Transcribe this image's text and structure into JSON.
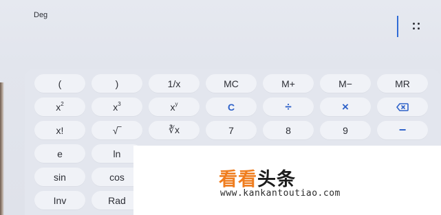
{
  "display": {
    "mode": "Deg"
  },
  "icons": {
    "menu": "grid-dots-icon",
    "backspace": "backspace-icon"
  },
  "colors": {
    "accent": "#2f62c9",
    "background": "#e3e6ee",
    "key": "#f0f2f7",
    "watermark_orange": "#ef7d1f"
  },
  "keys": {
    "row1": [
      "(",
      ")",
      "1/x",
      "MC",
      "M+",
      "M−",
      "MR"
    ],
    "row2": {
      "x2": "x",
      "x2_sup": "2",
      "x3": "x",
      "x3_sup": "3",
      "xy": "x",
      "xy_sup": "y",
      "clear": "C",
      "divide": "÷",
      "multiply": "×"
    },
    "row3": {
      "factorial": "x!",
      "sqrt": "√‾",
      "yroot": "∛x",
      "seven": "7",
      "eight": "8",
      "nine": "9",
      "minus": "−"
    },
    "row4": [
      "e",
      "ln"
    ],
    "row5": [
      "sin",
      "cos"
    ],
    "row6": [
      "Inv",
      "Rad"
    ]
  },
  "watermark": {
    "title_part1": "看看",
    "title_part2": "头条",
    "url": "www.kankantoutiao.com"
  }
}
